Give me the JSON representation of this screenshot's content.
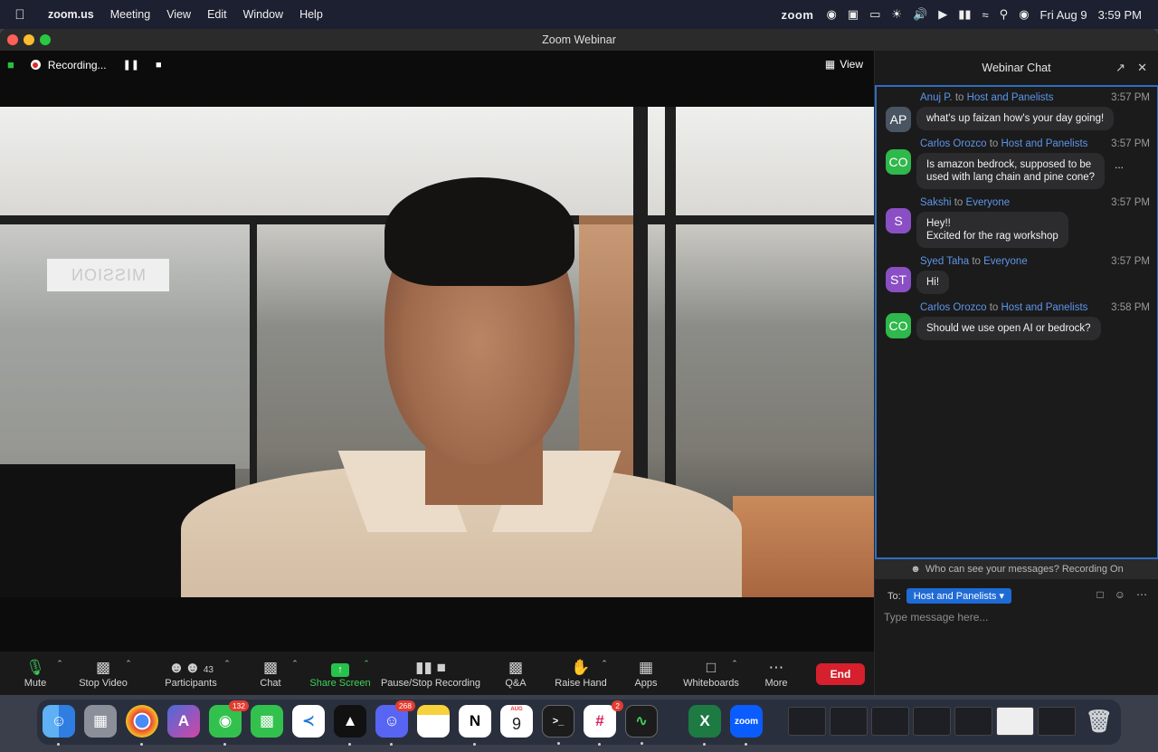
{
  "menubar": {
    "app": "zoom.us",
    "items": [
      "Meeting",
      "View",
      "Edit",
      "Window",
      "Help"
    ],
    "status_app": "zoom",
    "date": "Fri Aug 9",
    "time": "3:59 PM"
  },
  "window": {
    "title": "Zoom Webinar"
  },
  "recording": {
    "status": "Recording...",
    "view_label": "View"
  },
  "video": {
    "sign_text": "MISSION"
  },
  "toolbar": {
    "mute": "Mute",
    "stop_video": "Stop Video",
    "participants": "Participants",
    "participants_count": "43",
    "chat": "Chat",
    "share_screen": "Share Screen",
    "recording": "Pause/Stop Recording",
    "qa": "Q&A",
    "raise_hand": "Raise Hand",
    "apps": "Apps",
    "whiteboards": "Whiteboards",
    "more": "More",
    "end": "End"
  },
  "chat": {
    "title": "Webinar Chat",
    "messages": [
      {
        "initials": "AP",
        "color": "#4a5563",
        "sender": "Anuj P.",
        "to": "to",
        "target": "Host and Panelists",
        "time": "3:57 PM",
        "lines": [
          "what's up faizan how's your day going!"
        ]
      },
      {
        "initials": "CO",
        "color": "#2fb84b",
        "sender": "Carlos Orozco",
        "to": "to",
        "target": "Host and Panelists",
        "time": "3:57 PM",
        "lines": [
          "Is amazon bedrock, supposed to be",
          "used with lang chain and pine cone?"
        ]
      },
      {
        "initials": "S",
        "color": "#8a4fc4",
        "sender": "Sakshi",
        "to": "to",
        "target": "Everyone",
        "time": "3:57 PM",
        "lines": [
          "Hey!!",
          "Excited for the rag workshop"
        ]
      },
      {
        "initials": "ST",
        "color": "#8a4fc4",
        "sender": "Syed Taha",
        "to": "to",
        "target": "Everyone",
        "time": "3:57 PM",
        "lines": [
          "Hi!"
        ]
      },
      {
        "initials": "CO",
        "color": "#2fb84b",
        "sender": "Carlos Orozco",
        "to": "to",
        "target": "Host and Panelists",
        "time": "3:58 PM",
        "lines": [
          "Should we use open AI or bedrock?"
        ]
      }
    ],
    "more_menu": "...",
    "privacy_notice": "Who can see your messages? Recording On",
    "to_label": "To:",
    "to_value": "Host and Panelists",
    "input_placeholder": "Type message here..."
  },
  "dock": {
    "apps": [
      {
        "name": "Finder"
      },
      {
        "name": "Launchpad"
      },
      {
        "name": "Chrome"
      },
      {
        "name": "Affinity"
      },
      {
        "name": "Messages",
        "badge": "132"
      },
      {
        "name": "FaceTime"
      },
      {
        "name": "VS Code"
      },
      {
        "name": "Cursor"
      },
      {
        "name": "Discord",
        "badge": "268"
      },
      {
        "name": "Notes"
      },
      {
        "name": "Notion",
        "glyph": "N"
      },
      {
        "name": "Calendar",
        "month": "AUG",
        "day": "9"
      },
      {
        "name": "Terminal",
        "glyph": ">_"
      },
      {
        "name": "Slack",
        "badge": "2"
      },
      {
        "name": "Activity Monitor"
      },
      {
        "name": "Excel",
        "glyph": "X"
      },
      {
        "name": "Zoom",
        "glyph": "zoom"
      }
    ]
  }
}
